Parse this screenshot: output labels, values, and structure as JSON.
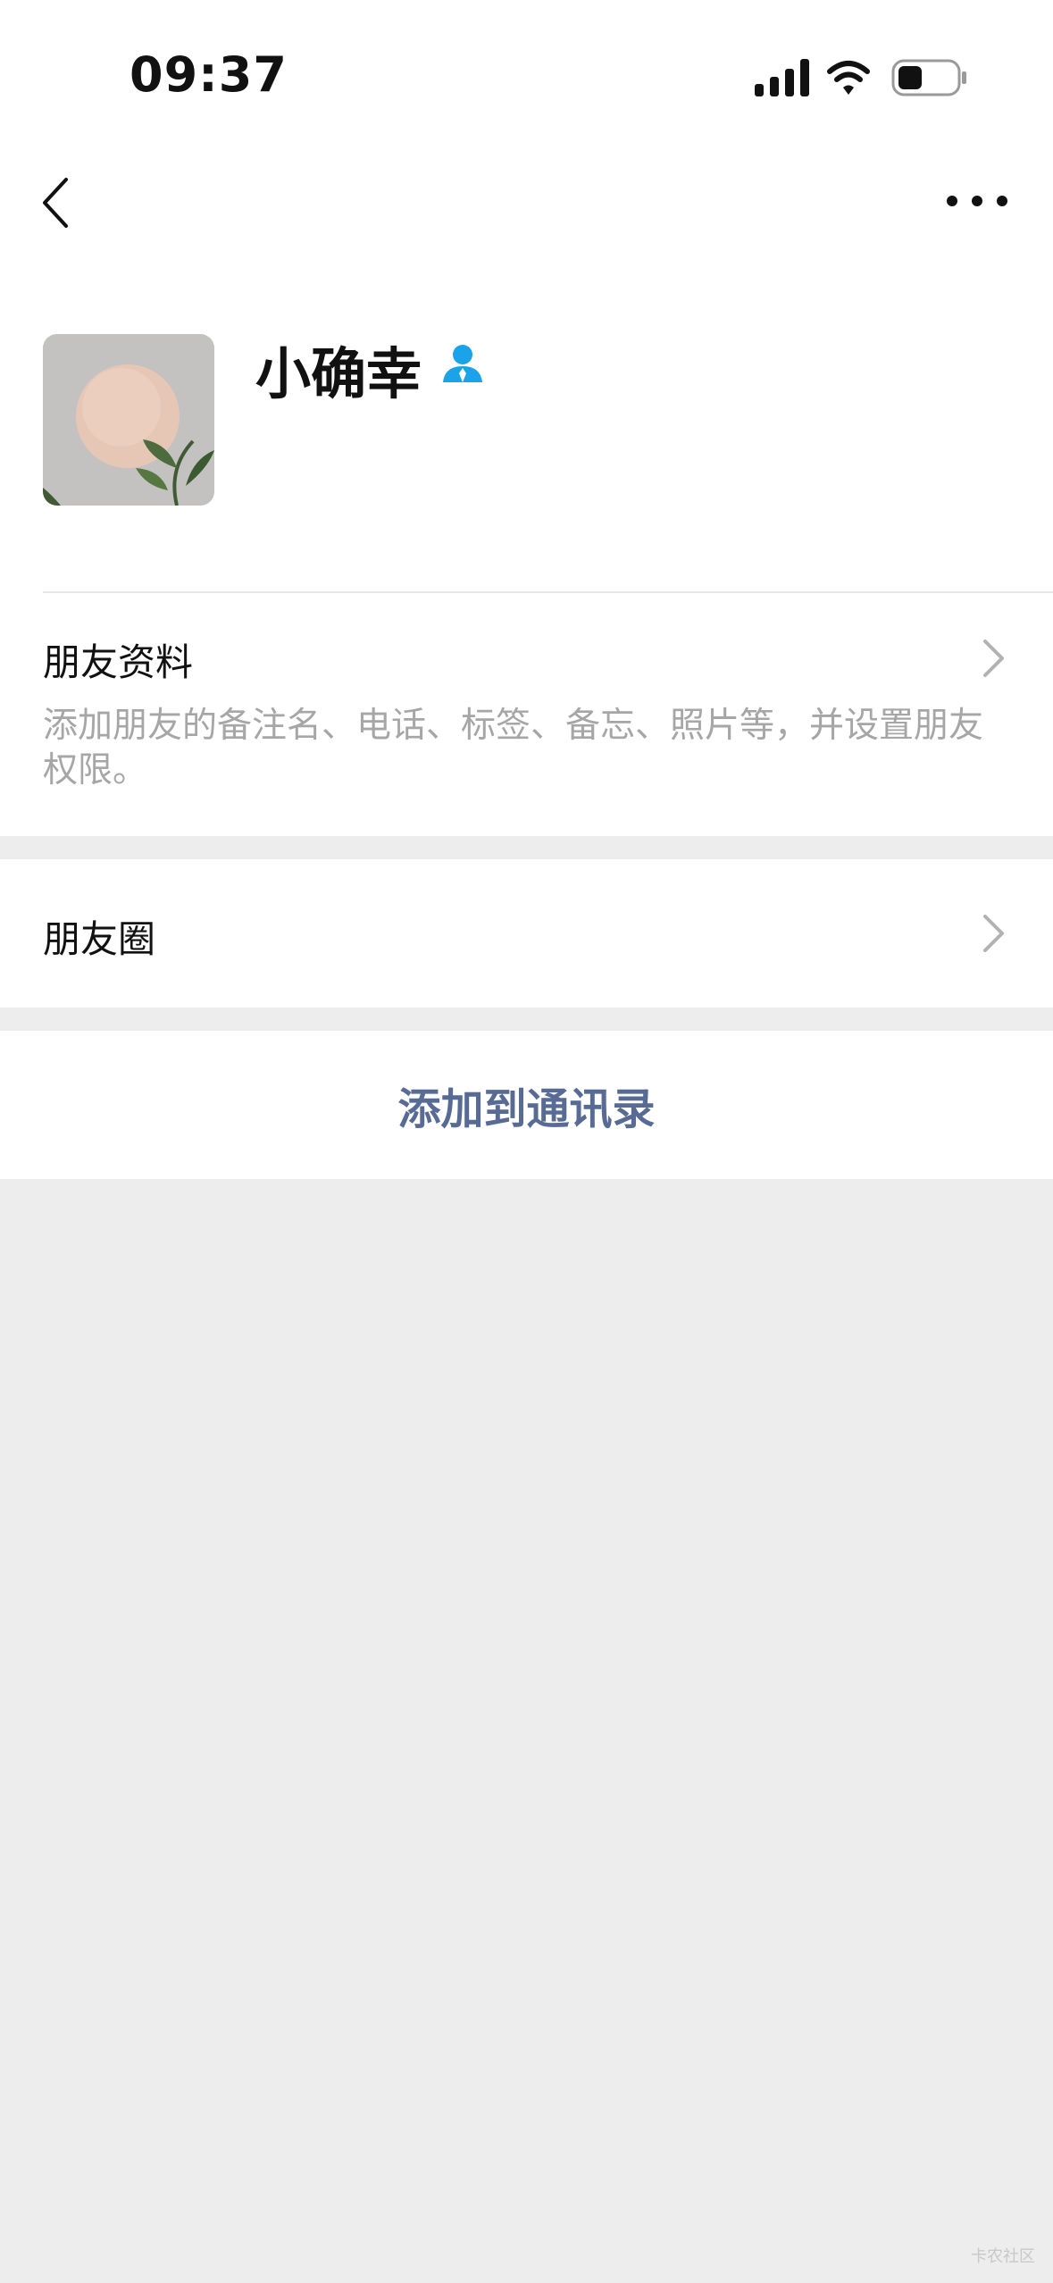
{
  "status_bar": {
    "time": "09:37"
  },
  "profile": {
    "name": "小确幸",
    "badge_icon": "contact-person-icon",
    "badge_color": "#1aa3e8"
  },
  "friend_info": {
    "title": "朋友资料",
    "description": "添加朋友的备注名、电话、标签、备忘、照片等，并设置朋友权限。"
  },
  "moments": {
    "title": "朋友圈"
  },
  "actions": {
    "add_to_contacts": "添加到通讯录"
  },
  "watermark": "卡农社区",
  "colors": {
    "link_blue": "#576b95",
    "background": "#ededed",
    "secondary_text": "#a6a6a6"
  }
}
